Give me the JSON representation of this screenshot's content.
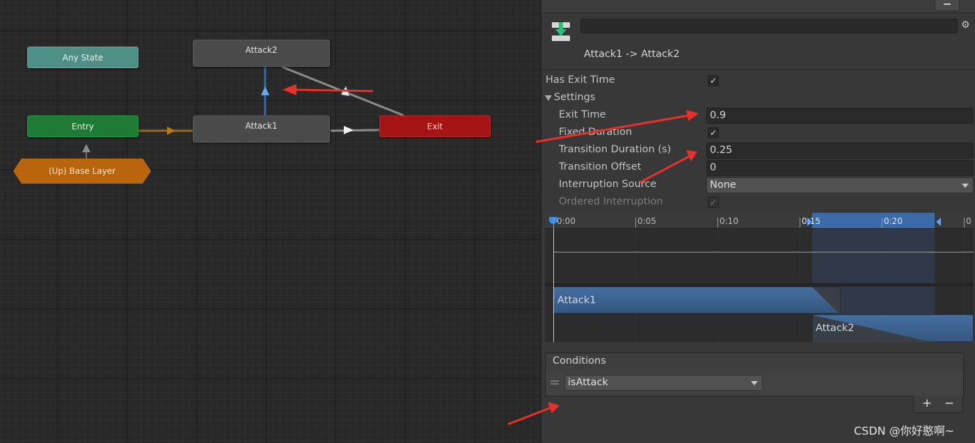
{
  "graph": {
    "nodes": {
      "any_state": "Any State",
      "entry": "Entry",
      "base_layer": "(Up) Base Layer",
      "attack2": "Attack2",
      "attack1": "Attack1",
      "exit": "Exit"
    }
  },
  "inspector": {
    "transition_title": "Attack1 -> Attack2",
    "has_exit_time_label": "Has Exit Time",
    "has_exit_time_checked": "✓",
    "settings_label": "Settings",
    "exit_time_label": "Exit Time",
    "exit_time_value": "0.9",
    "fixed_duration_label": "Fixed Duration",
    "fixed_duration_checked": "✓",
    "transition_duration_label": "Transition Duration (s)",
    "transition_duration_value": "0.25",
    "transition_offset_label": "Transition Offset",
    "transition_offset_value": "0",
    "interruption_source_label": "Interruption Source",
    "interruption_source_value": "None",
    "ordered_interruption_label": "Ordered Interruption",
    "ordered_interruption_checked": "✓"
  },
  "timeline": {
    "ticks": [
      "0:00",
      "0:05",
      "0:10",
      "0:15",
      "0:20",
      "0"
    ],
    "clip1": "Attack1",
    "clip2": "Attack2"
  },
  "conditions": {
    "header": "Conditions",
    "items": [
      {
        "parameter": "isAttack"
      }
    ],
    "add_label": "+",
    "remove_label": "−"
  },
  "watermark": "CSDN @你好憨啊~",
  "colors": {
    "any_state": "#4e8f86",
    "entry": "#1e7a34",
    "base_layer": "#b8650e",
    "exit": "#a31515",
    "selected_blue": "#3c6aa8",
    "annotation_red": "#e8312a"
  }
}
